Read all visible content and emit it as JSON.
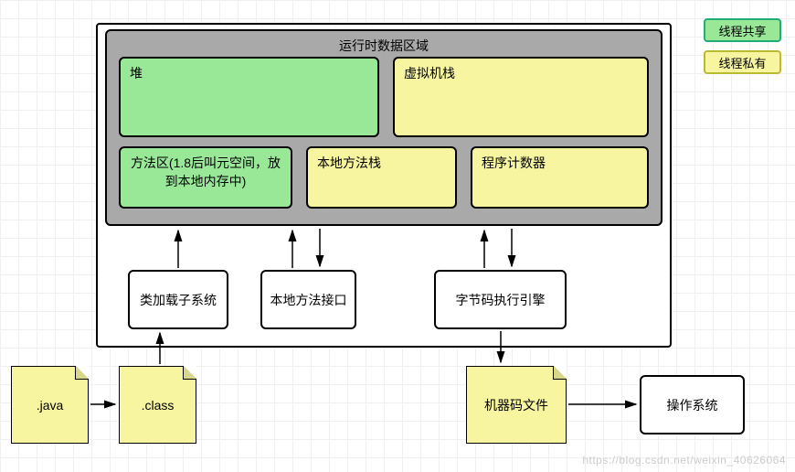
{
  "runtime": {
    "title": "运行时数据区域",
    "heap": "堆",
    "vm_stack": "虚拟机栈",
    "method_area": "方法区(1.8后叫元空间，放到本地内存中)",
    "native_stack": "本地方法栈",
    "pc": "程序计数器"
  },
  "sub": {
    "classloader": "类加载子系统",
    "native_interface": "本地方法接口",
    "exec_engine": "字节码执行引擎"
  },
  "files": {
    "java": ".java",
    "class": ".class",
    "machine": "机器码文件",
    "os": "操作系统"
  },
  "legend": {
    "shared": "线程共享",
    "private": "线程私有"
  },
  "watermark": "https://blog.csdn.net/weixin_40626064"
}
